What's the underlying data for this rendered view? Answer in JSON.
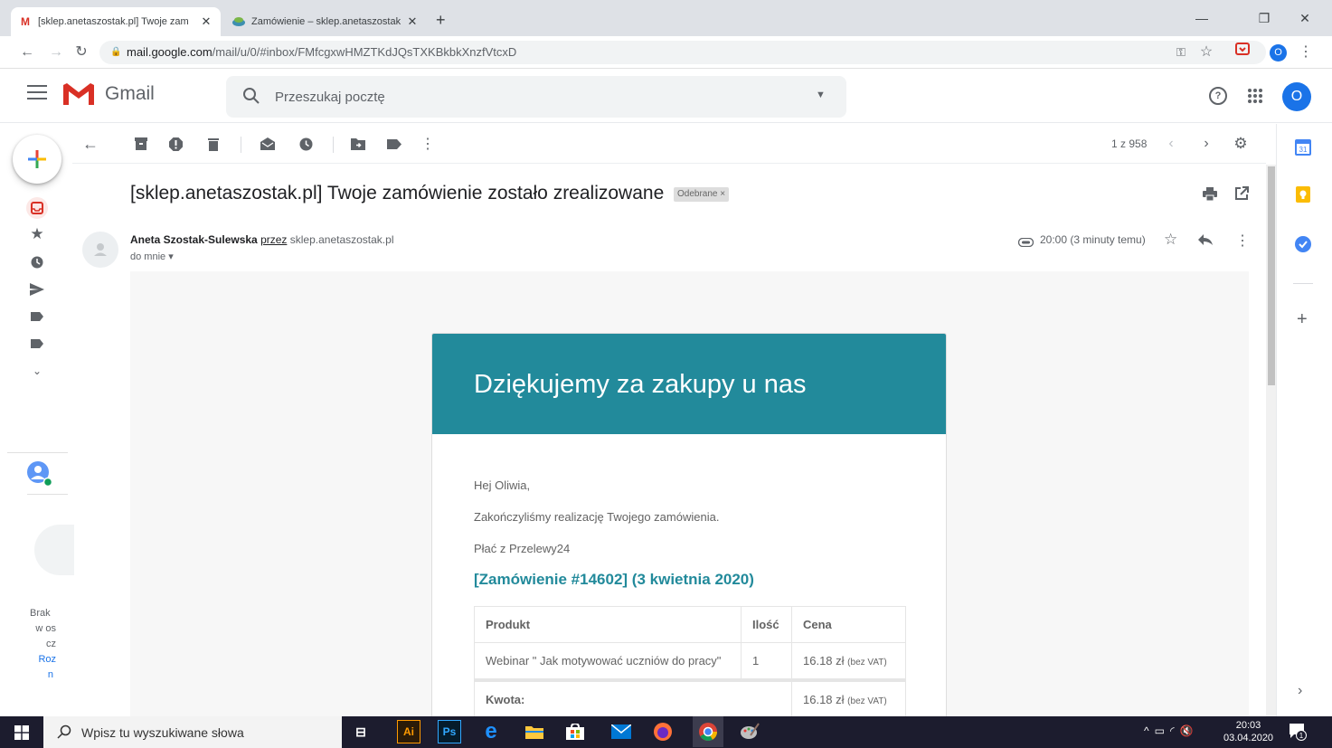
{
  "browser": {
    "tabs": [
      {
        "title": "[sklep.anetaszostak.pl] Twoje zam",
        "favicon": "gmail-icon",
        "active": true
      },
      {
        "title": "Zamówienie – sklep.anetaszostak",
        "favicon": "shop-icon",
        "active": false
      }
    ],
    "new_tab": "+",
    "url_host": "mail.google.com",
    "url_path": "/mail/u/0/#inbox/FMfcgxwHMZTKdJQsTXKBkbkXnzfVtcxD",
    "profile_initial": "O"
  },
  "gmail": {
    "logo_text": "Gmail",
    "search_placeholder": "Przeszukaj pocztę",
    "account_initial": "O",
    "pagination": "1 z 958"
  },
  "left_panel": {
    "hangouts_text": [
      "Brak",
      "w os",
      "cz",
      "Roz",
      "n"
    ]
  },
  "message": {
    "subject": "[sklep.anetaszostak.pl] Twoje zamówienie zostało zrealizowane",
    "label": "Odebrane ×",
    "sender_name": "Aneta Szostak-Sulewska",
    "via": "przez",
    "via_domain": "sklep.anetaszostak.pl",
    "to": "do mnie ▾",
    "time": "20:00 (3 minuty temu)"
  },
  "email_body": {
    "header": "Dziękujemy za zakupy u nas",
    "greeting": "Hej Oliwia,",
    "line1": "Zakończyliśmy realizację Twojego zamówienia.",
    "line2": "Płać z Przelewy24",
    "order_title": "[Zamówienie #14602] (3 kwietnia 2020)",
    "table": {
      "headers": [
        "Produkt",
        "Ilość",
        "Cena"
      ],
      "row": {
        "product": "Webinar \" Jak motywować uczniów do pracy\"",
        "qty": "1",
        "price": "16.18 zł",
        "price_note": "(bez VAT)"
      },
      "total_label": "Kwota:",
      "total_price": "16.18 zł",
      "total_note": "(bez VAT)"
    }
  },
  "taskbar": {
    "search_placeholder": "Wpisz tu wyszukiwane słowa",
    "time": "20:03",
    "date": "03.04.2020",
    "notif_count": "1"
  },
  "colors": {
    "email_accent": "#228a9b",
    "gmail_red": "#d93025",
    "avatar_blue": "#1a73e8"
  }
}
